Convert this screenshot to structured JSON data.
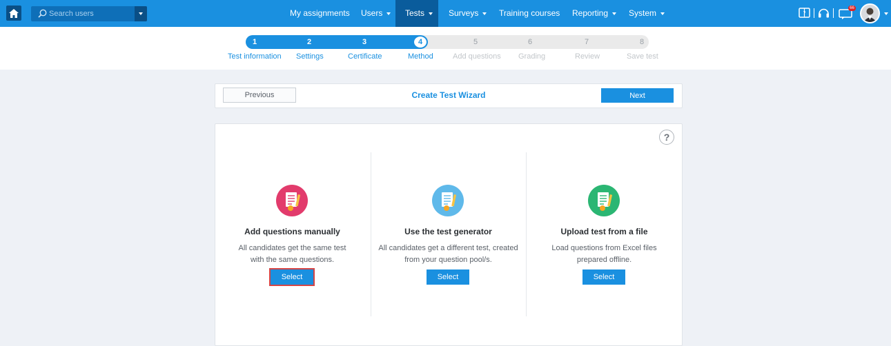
{
  "search": {
    "placeholder": "Search users"
  },
  "nav": {
    "items": [
      {
        "label": "My assignments",
        "dropdown": false
      },
      {
        "label": "Users",
        "dropdown": true
      },
      {
        "label": "Tests",
        "dropdown": true,
        "active": true
      },
      {
        "label": "Surveys",
        "dropdown": true
      },
      {
        "label": "Training courses",
        "dropdown": false
      },
      {
        "label": "Reporting",
        "dropdown": true
      },
      {
        "label": "System",
        "dropdown": true
      }
    ],
    "notification_count": "66"
  },
  "steps": [
    {
      "num": "1",
      "label": "Test information",
      "state": "done"
    },
    {
      "num": "2",
      "label": "Settings",
      "state": "done"
    },
    {
      "num": "3",
      "label": "Certificate",
      "state": "done"
    },
    {
      "num": "4",
      "label": "Method",
      "state": "current"
    },
    {
      "num": "5",
      "label": "Add questions",
      "state": "todo"
    },
    {
      "num": "6",
      "label": "Grading",
      "state": "todo"
    },
    {
      "num": "7",
      "label": "Review",
      "state": "todo"
    },
    {
      "num": "8",
      "label": "Save test",
      "state": "todo"
    }
  ],
  "wizard": {
    "title": "Create Test Wizard",
    "previous_label": "Previous",
    "next_label": "Next",
    "help_label": "?"
  },
  "options": [
    {
      "title": "Add questions manually",
      "desc_line1": "All candidates get the same test",
      "desc_line2": "with the same questions.",
      "select_label": "Select",
      "icon_color": "#e23b6c"
    },
    {
      "title": "Use the test generator",
      "desc_line1": "All candidates get a different test, created",
      "desc_line2": "from your question pool/s.",
      "select_label": "Select",
      "icon_color": "#5fb9ea"
    },
    {
      "title": "Upload test from a file",
      "desc_line1": "Load questions from Excel files",
      "desc_line2": "prepared offline.",
      "select_label": "Select",
      "icon_color": "#2bb673"
    }
  ],
  "colors": {
    "brand": "#1a90e0",
    "nav_active": "#0a5c9c",
    "highlight": "#d64545"
  }
}
